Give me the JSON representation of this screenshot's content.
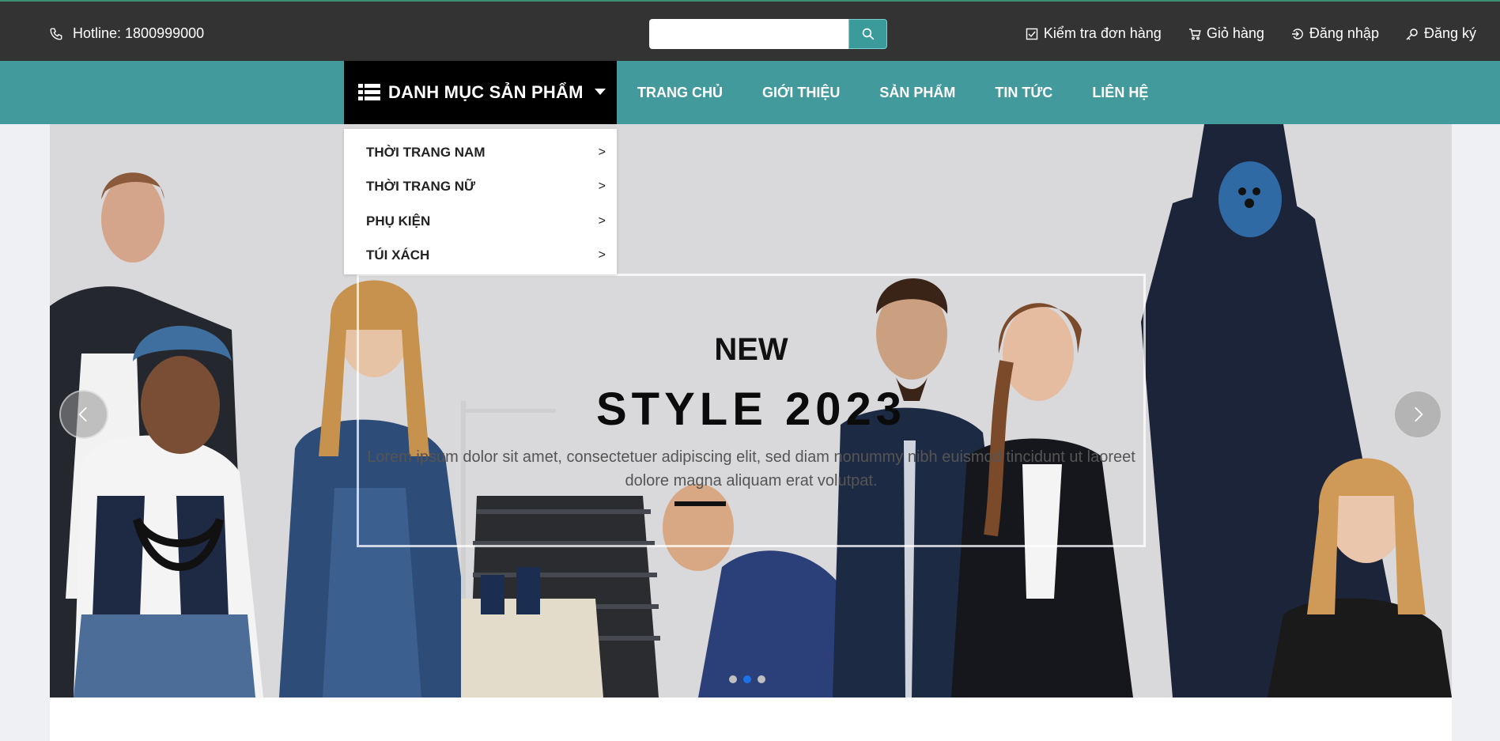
{
  "topbar": {
    "hotline": "Hotline: 1800999000",
    "search_placeholder": "",
    "links": [
      {
        "label": "Kiểm tra đơn hàng",
        "icon": "checkbox-icon"
      },
      {
        "label": "Giỏ hàng",
        "icon": "cart-icon"
      },
      {
        "label": "Đăng nhập",
        "icon": "login-icon"
      },
      {
        "label": "Đăng ký",
        "icon": "key-icon"
      }
    ]
  },
  "nav": {
    "category_label": "DANH MỤC SẢN PHẨM",
    "links": [
      "TRANG CHỦ",
      "GIỚI THIỆU",
      "SẢN PHẨM",
      "TIN TỨC",
      "LIÊN HỆ"
    ]
  },
  "dropdown": {
    "items": [
      "THỜI TRANG NAM",
      "THỜI TRANG NỮ",
      "PHỤ KIỆN",
      "TÚI XÁCH"
    ],
    "arrow": ">"
  },
  "banner": {
    "title_small": "NEW",
    "title_big": "STYLE 2023",
    "text": "Lorem ipsum dolor sit amet, consectetuer adipiscing elit, sed diam nonummy nibh euismod tincidunt ut laoreet dolore magna aliquam erat volutpat.",
    "slides_count": 3,
    "active_slide": 2
  },
  "colors": {
    "topbar_bg": "#333333",
    "nav_bg": "#439a9c",
    "accent": "#3b9a9a",
    "active_dot": "#1a73e8"
  }
}
